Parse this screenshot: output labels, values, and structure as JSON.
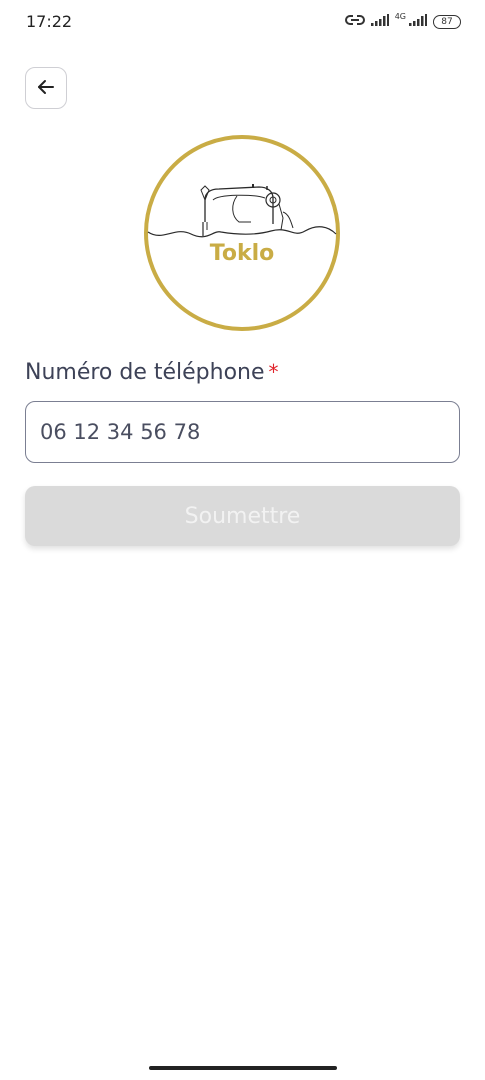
{
  "status_bar": {
    "time": "17:22",
    "network_label": "4G",
    "battery": "87",
    "icons": [
      "link-icon",
      "signal-icon",
      "signal-4g-icon",
      "battery-icon"
    ]
  },
  "header": {
    "back_icon": "arrow-left-icon"
  },
  "logo": {
    "brand": "Toklo",
    "icon": "sewing-machine-icon",
    "accent_color": "#c9ac45"
  },
  "form": {
    "phone_label": "Numéro de téléphone",
    "required_mark": "*",
    "phone_placeholder": "06 12 34 56 78",
    "submit_label": "Soumettre"
  },
  "colors": {
    "text": "#3d4257",
    "required": "#e0242b",
    "button_disabled_bg": "#dadada",
    "button_disabled_text": "#f2f2f2"
  }
}
